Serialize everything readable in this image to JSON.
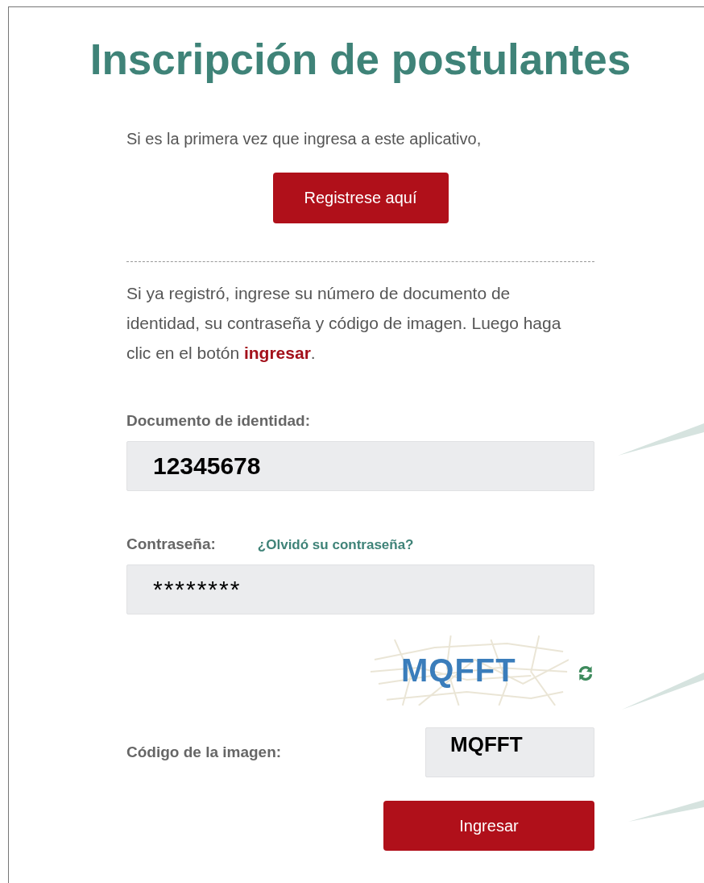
{
  "title": "Inscripción de postulantes",
  "intro": "Si es la primera vez que ingresa a este aplicativo,",
  "register_button": "Registrese aquí",
  "instructions": "Si ya registró, ingrese su número de documento de identidad, su contraseña y código de imagen. Luego haga clic en el botón **ingresar**.",
  "fields": [
    {
      "kind": "text",
      "label": "Documento de identidad:",
      "value": "12345678"
    },
    {
      "kind": "password",
      "label": "Contraseña:",
      "link": "¿Olvidó su contraseña?",
      "value": "********"
    },
    {
      "kind": "captcha",
      "captcha_text": "MQFFT",
      "label": "Código de la imagen:",
      "value": "MQFFT"
    }
  ],
  "submit_button": "Ingresar"
}
